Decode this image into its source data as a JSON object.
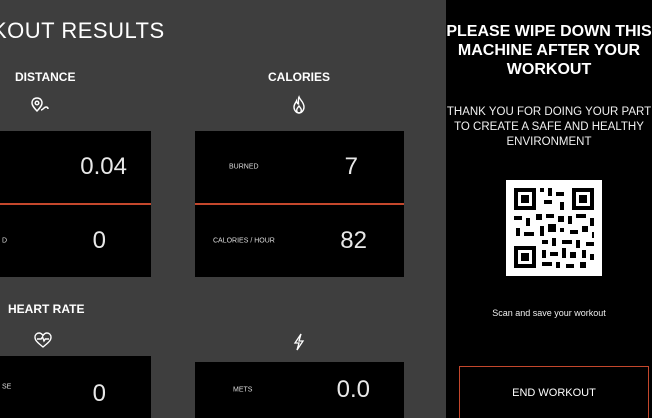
{
  "header": {
    "title": "KOUT RESULTS"
  },
  "sections": {
    "distance": {
      "label": "DISTANCE",
      "icon": "location-pin-icon"
    },
    "calories": {
      "label": "CALORIES",
      "icon": "flame-icon"
    },
    "heart_rate": {
      "label": "HEART RATE",
      "icon": "heart-icon"
    },
    "mets": {
      "icon": "lightning-icon"
    }
  },
  "metrics": {
    "distance": {
      "label": "",
      "value": "0.04"
    },
    "speed": {
      "label": "D",
      "value": "0"
    },
    "burned": {
      "label": "BURNED",
      "value": "7"
    },
    "calories_hour": {
      "label": "CALORIES / HOUR",
      "value": "82"
    },
    "heart": {
      "label": "SE",
      "value": "0"
    },
    "mets": {
      "label": "METS",
      "value": "0.0"
    }
  },
  "notice": {
    "title": "PLEASE WIPE DOWN THIS MACHINE AFTER YOUR WORKOUT",
    "subtitle": "THANK YOU FOR DOING YOUR PART TO CREATE A SAFE AND HEALTHY ENVIRONMENT",
    "scan_text": "Scan and save your workout",
    "qr_icon": "qr-code-icon",
    "end_button": "END WORKOUT"
  },
  "colors": {
    "accent": "#c4472c",
    "panel": "#3e3e3e",
    "card": "#000000"
  }
}
